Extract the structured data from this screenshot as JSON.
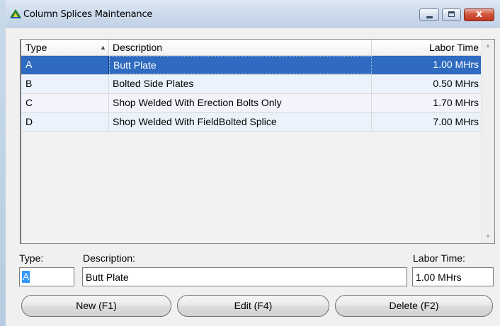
{
  "window": {
    "title": "Column Splices Maintenance",
    "controls": {
      "close": "x"
    }
  },
  "list": {
    "columns": {
      "type": "Type",
      "description": "Description",
      "labor_time": "Labor Time"
    },
    "sort_column": "type",
    "sort_direction": "ascending",
    "selected_index": 0,
    "rows": [
      {
        "type": "A",
        "description": "Butt Plate",
        "labor_time": "1.00 MHrs"
      },
      {
        "type": "B",
        "description": "Bolted Side Plates",
        "labor_time": "0.50 MHrs"
      },
      {
        "type": "C",
        "description": "Shop Welded With Erection Bolts Only",
        "labor_time": "1.70 MHrs"
      },
      {
        "type": "D",
        "description": "Shop Welded With FieldBolted Splice",
        "labor_time": "7.00 MHrs"
      }
    ]
  },
  "form": {
    "type_label": "Type:",
    "description_label": "Description:",
    "labor_label": "Labor Time:",
    "type_value": "A",
    "description_value": "Butt Plate",
    "labor_value": "1.00 MHrs"
  },
  "buttons": {
    "new": "New (F1)",
    "edit": "Edit (F4)",
    "delete": "Delete (F2)"
  },
  "colors": {
    "selection": "#2f6bc0",
    "text_selection": "#3399ff",
    "close_button": "#c1391f"
  }
}
